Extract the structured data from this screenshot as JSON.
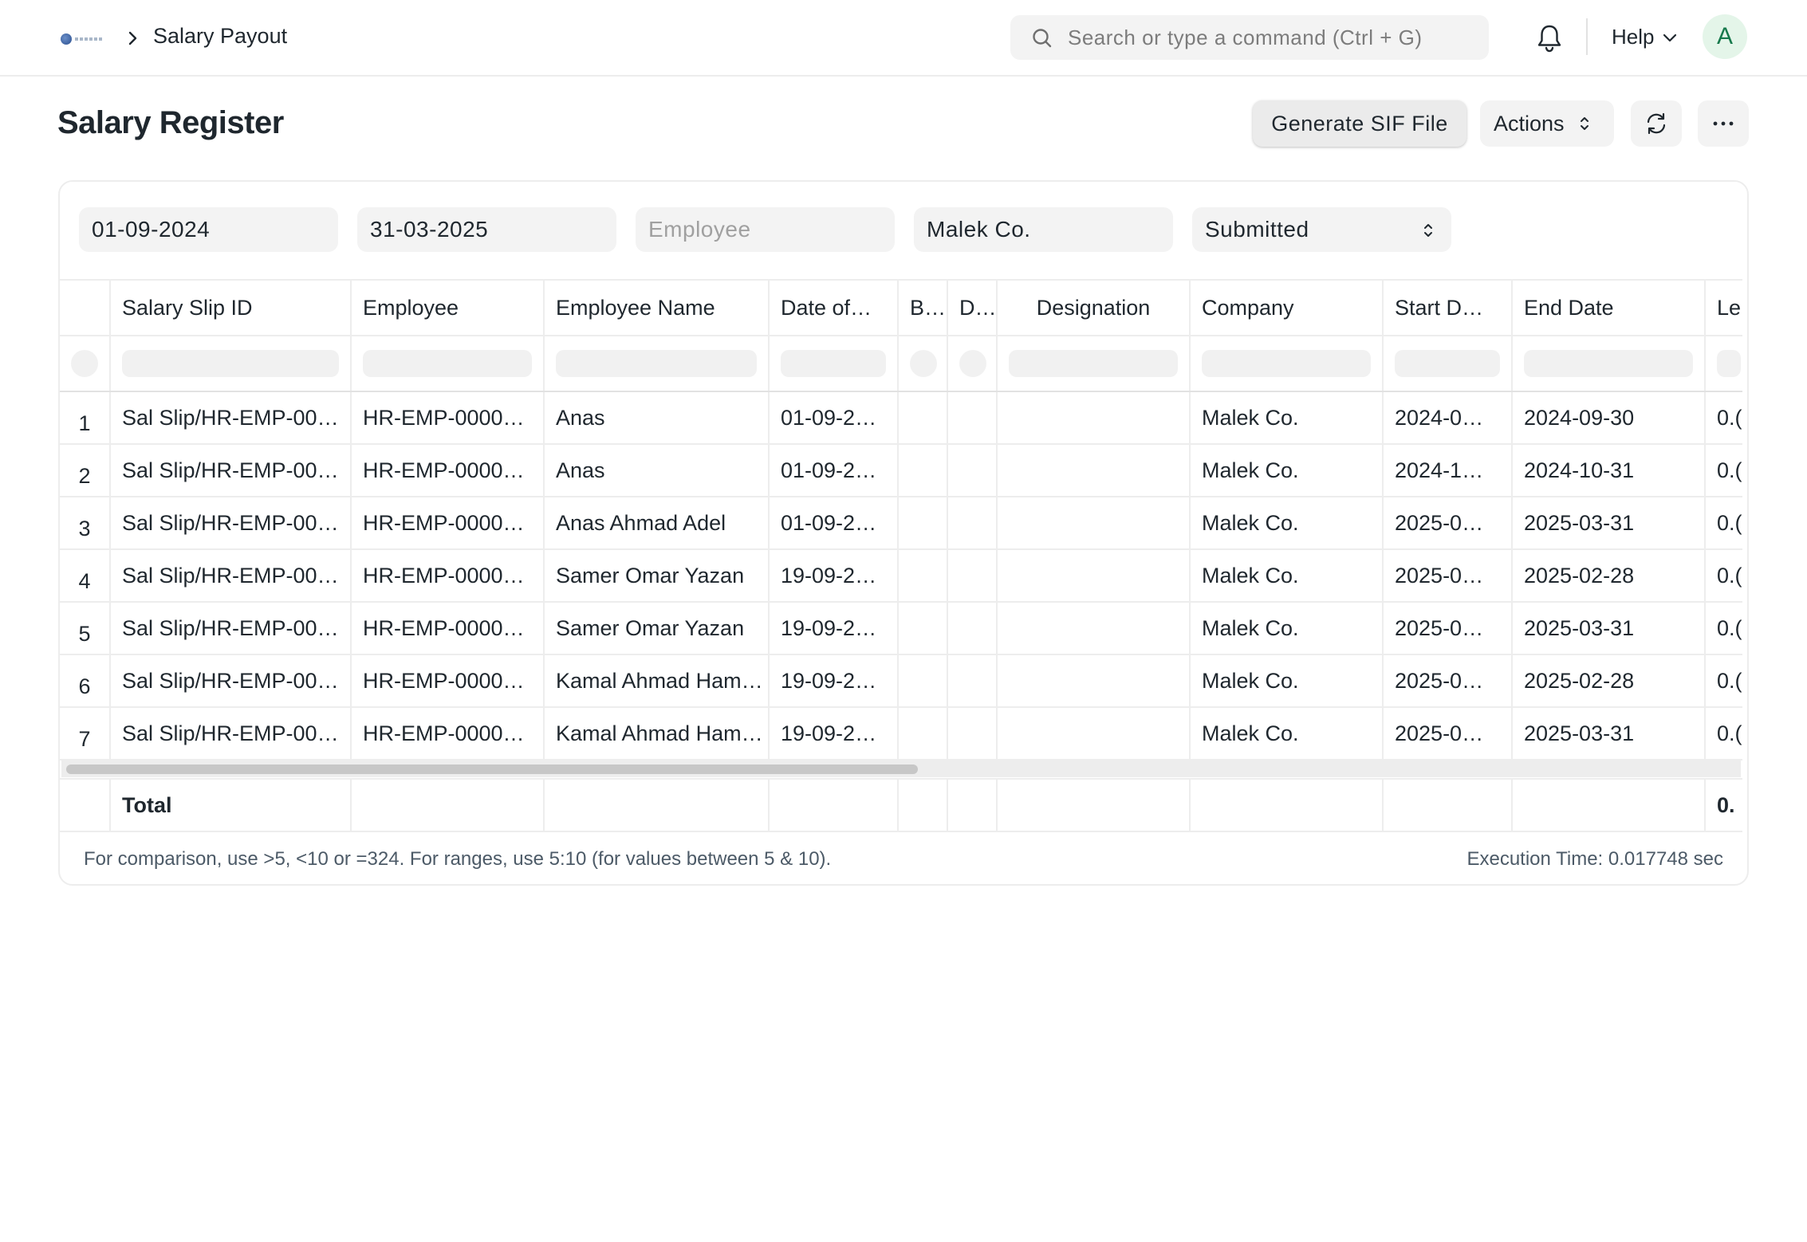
{
  "navbar": {
    "breadcrumb": "Salary Payout",
    "search_placeholder": "Search or type a command (Ctrl + G)",
    "help_label": "Help",
    "avatar_letter": "A"
  },
  "page": {
    "title": "Salary Register",
    "buttons": {
      "generate_sif": "Generate SIF File",
      "actions": "Actions"
    }
  },
  "filters": {
    "from_date": "01-09-2024",
    "to_date": "31-03-2025",
    "employee_placeholder": "Employee",
    "company": "Malek Co.",
    "docstatus": "Submitted"
  },
  "table": {
    "columns": [
      "",
      "Salary Slip ID",
      "Employee",
      "Employee Name",
      "Date of…",
      "B…",
      "D…",
      "Designation",
      "Company",
      "Start D…",
      "End Date",
      "Le"
    ],
    "rows": [
      [
        "1",
        "Sal Slip/HR-EMP-00…",
        "HR-EMP-0000…",
        "Anas",
        "01-09-2…",
        "",
        "",
        "",
        "Malek Co.",
        "2024-0…",
        "2024-09-30",
        "0.("
      ],
      [
        "2",
        "Sal Slip/HR-EMP-00…",
        "HR-EMP-0000…",
        "Anas",
        "01-09-2…",
        "",
        "",
        "",
        "Malek Co.",
        "2024-1…",
        "2024-10-31",
        "0.("
      ],
      [
        "3",
        "Sal Slip/HR-EMP-00…",
        "HR-EMP-0000…",
        "Anas Ahmad Adel",
        "01-09-2…",
        "",
        "",
        "",
        "Malek Co.",
        "2025-0…",
        "2025-03-31",
        "0.("
      ],
      [
        "4",
        "Sal Slip/HR-EMP-00…",
        "HR-EMP-0000…",
        "Samer Omar Yazan",
        "19-09-2…",
        "",
        "",
        "",
        "Malek Co.",
        "2025-0…",
        "2025-02-28",
        "0.("
      ],
      [
        "5",
        "Sal Slip/HR-EMP-00…",
        "HR-EMP-0000…",
        "Samer Omar Yazan",
        "19-09-2…",
        "",
        "",
        "",
        "Malek Co.",
        "2025-0…",
        "2025-03-31",
        "0.("
      ],
      [
        "6",
        "Sal Slip/HR-EMP-00…",
        "HR-EMP-0000…",
        "Kamal Ahmad Ham…",
        "19-09-2…",
        "",
        "",
        "",
        "Malek Co.",
        "2025-0…",
        "2025-02-28",
        "0.("
      ],
      [
        "7",
        "Sal Slip/HR-EMP-00…",
        "HR-EMP-0000…",
        "Kamal Ahmad Ham…",
        "19-09-2…",
        "",
        "",
        "",
        "Malek Co.",
        "2025-0…",
        "2025-03-31",
        "0.("
      ]
    ],
    "total_label": "Total",
    "total_last_value": "0."
  },
  "footer": {
    "hint": "For comparison, use >5, <10 or =324. For ranges, use 5:10 (for values between 5 & 10).",
    "execution_time": "Execution Time: 0.017748 sec"
  }
}
